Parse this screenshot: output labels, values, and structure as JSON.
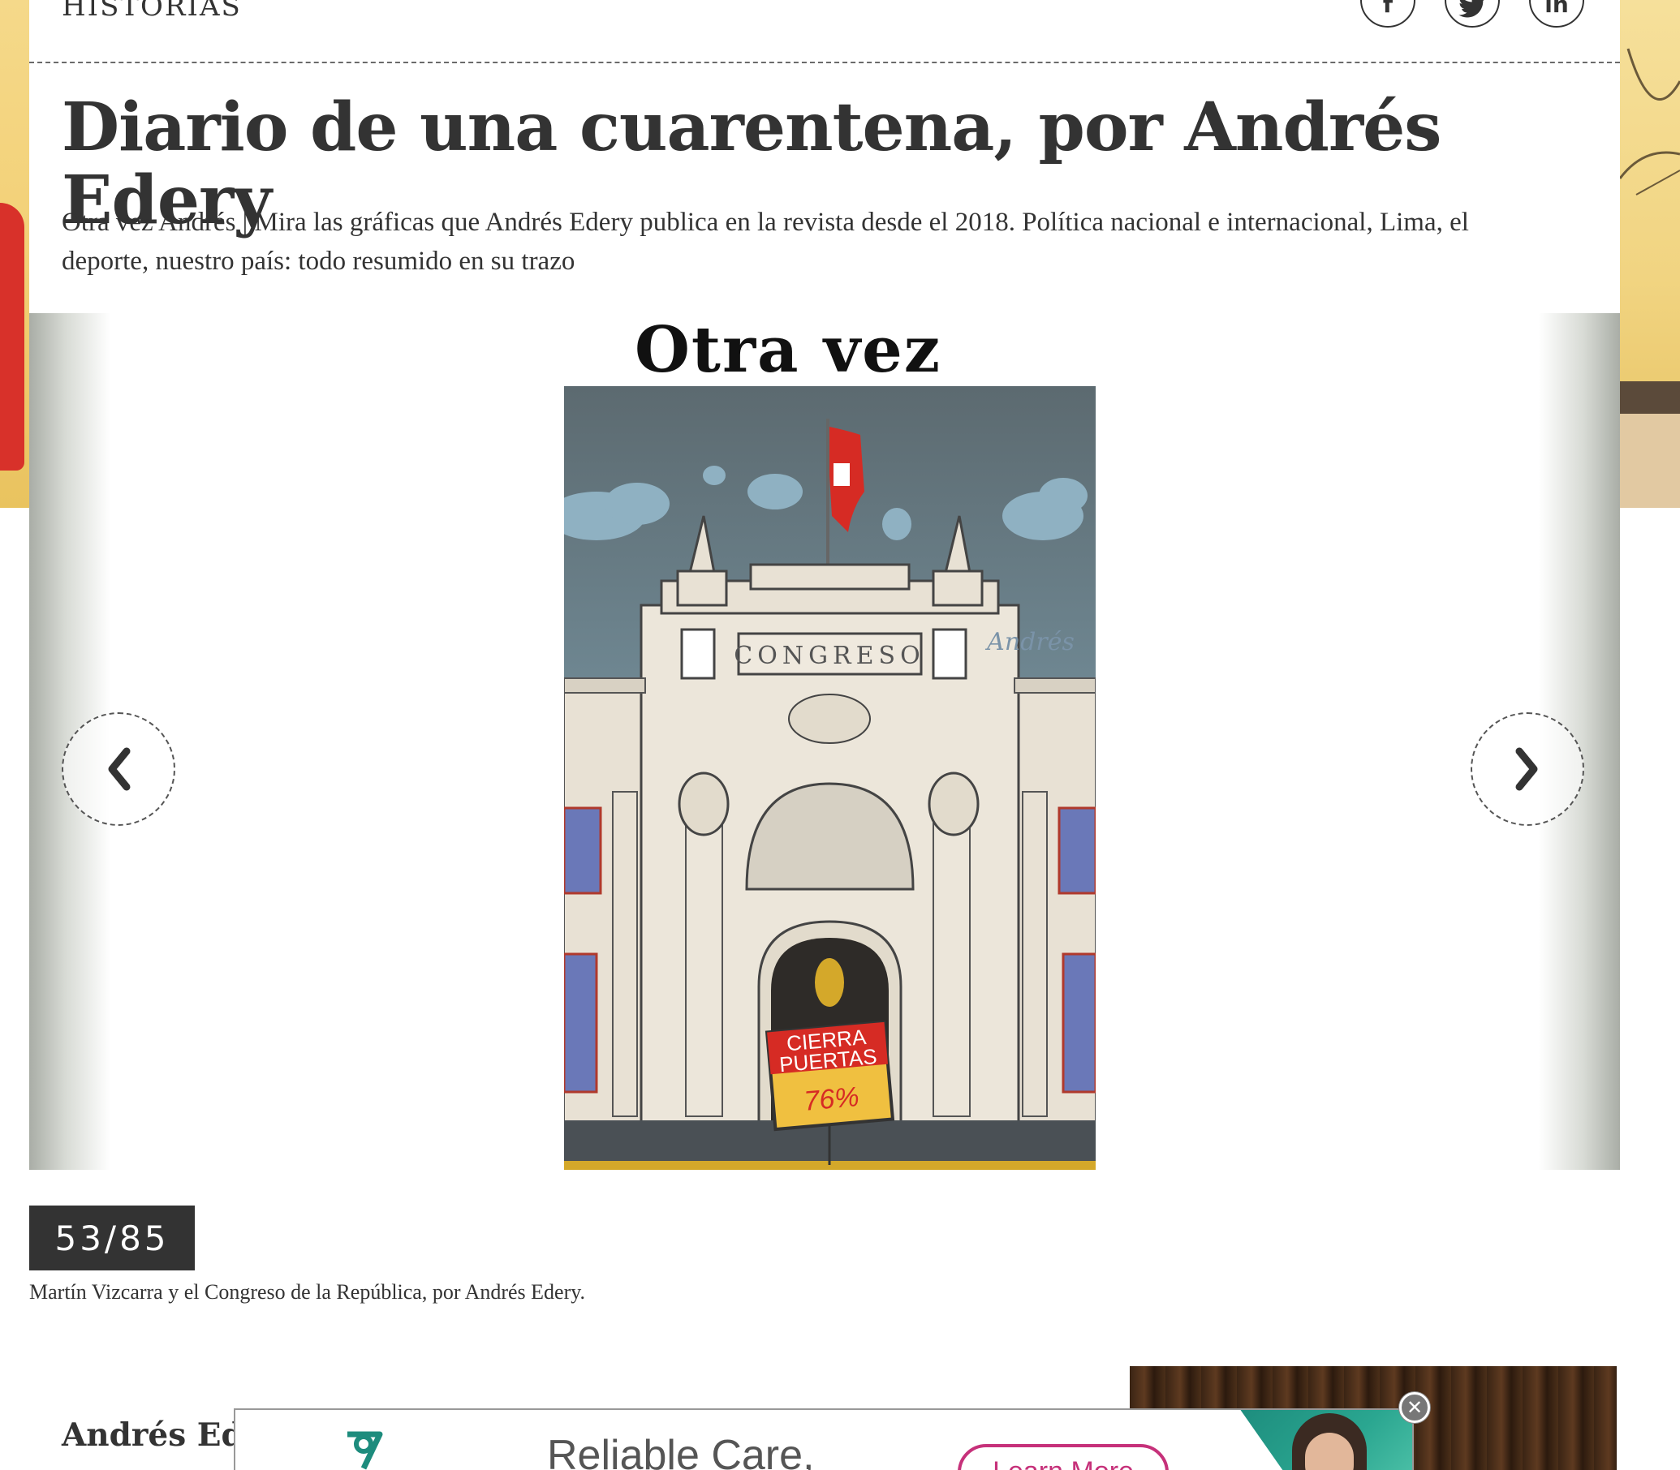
{
  "header": {
    "section_label": "HISTORIAS",
    "social": {
      "facebook": "f",
      "twitter": "t",
      "linkedin": "in"
    }
  },
  "article": {
    "title": "Diario de una cuarentena, por Andrés Edery",
    "subtitle": "Otra vez Andrés | Mira las gráficas que Andrés Edery publica en la revista desde el 2018. Política nacional e internacional, Lima, el deporte, nuestro país: todo resumido en su trazo"
  },
  "gallery": {
    "heading": "Otra vez Andrés",
    "image": {
      "building_sign": "CONGRESO",
      "signature": "Andrés",
      "sign_line1": "CIERRA",
      "sign_line2": "PUERTAS",
      "sign_value": "76%"
    },
    "counter": "53/85",
    "caption": "Martín Vizcarra y el Congreso de la República, por Andrés Edery."
  },
  "author": {
    "name": "Andrés Ede"
  },
  "ad": {
    "headline": "Reliable Care,",
    "cta": "Learn More",
    "close_icon": "close-icon"
  },
  "colors": {
    "text": "#333333",
    "counter_bg": "#333333",
    "ad_accent": "#c6317a",
    "ad_brand": "#1d8c7d"
  }
}
